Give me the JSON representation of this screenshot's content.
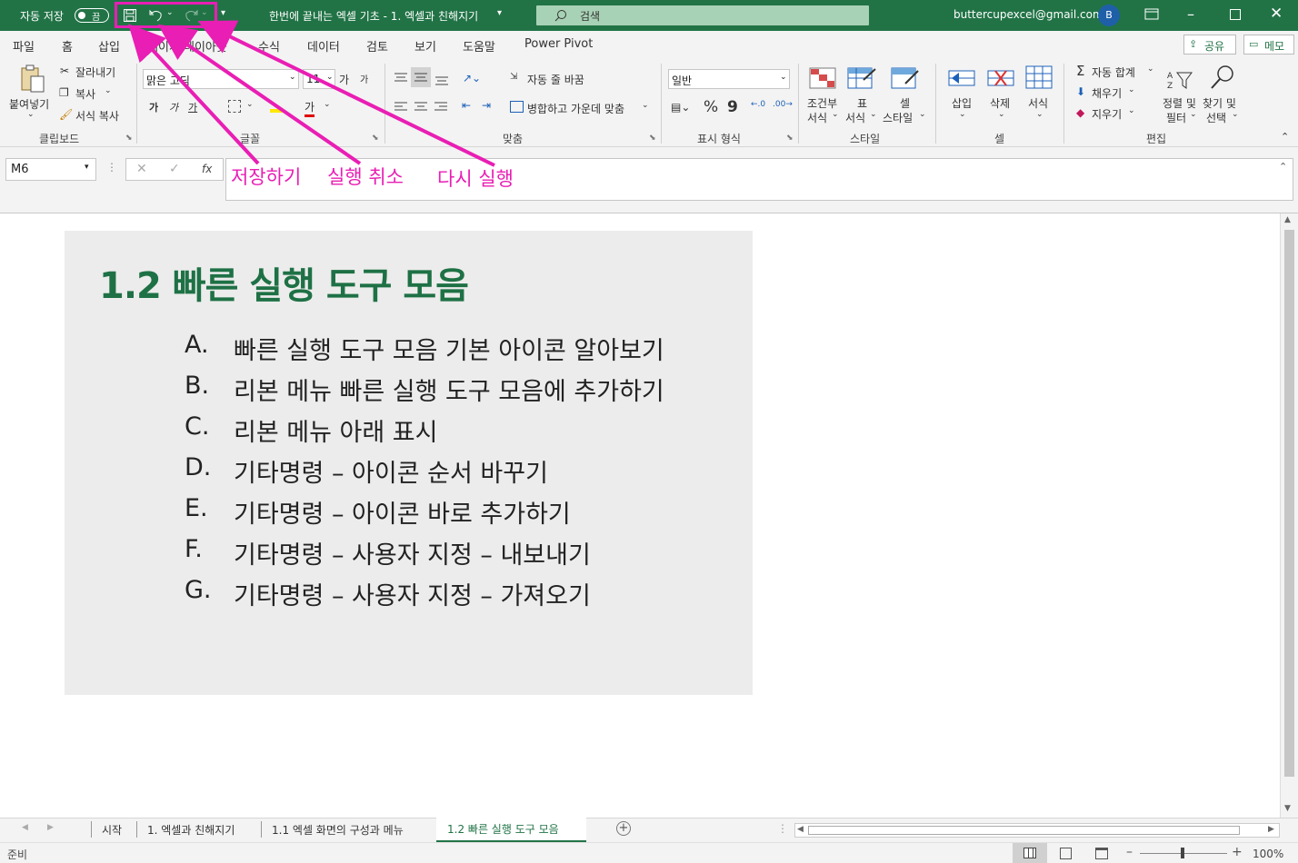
{
  "titlebar": {
    "autosave_label": "자동 저장",
    "autosave_state": "끔",
    "doc_title": "한번에 끝내는 엑셀 기초 - 1. 엑셀과 친해지기",
    "search_placeholder": "검색",
    "account_email": "buttercupexcel@gmail.com",
    "avatar_initial": "B"
  },
  "menu_tabs": [
    "파일",
    "홈",
    "삽입",
    "페이지 레이아웃",
    "수식",
    "데이터",
    "검토",
    "보기",
    "도움말",
    "Power Pivot"
  ],
  "share_label": "공유",
  "memo_label": "메모",
  "ribbon": {
    "clipboard": {
      "paste": "붙여넣기",
      "cut": "잘라내기",
      "copy": "복사",
      "format_painter": "서식 복사",
      "group": "클립보드"
    },
    "font": {
      "font_name": "맑은 고딕",
      "font_size": "11",
      "grow": "가",
      "shrink": "가",
      "bold": "가",
      "italic": "가",
      "underline": "가",
      "font_color": "가",
      "group": "글꼴"
    },
    "alignment": {
      "wrap": "자동 줄 바꿈",
      "merge": "병합하고 가운데 맞춤",
      "group": "맞춤"
    },
    "number": {
      "format": "일반",
      "percent": "%",
      "comma": "9",
      "group": "표시 형식"
    },
    "styles": {
      "conditional": "조건부\n서식",
      "table": "표\n서식",
      "cell": "셀\n스타일",
      "cond1": "조건부",
      "cond2": "서식",
      "table1": "표",
      "table2": "서식",
      "cell1": "셀",
      "cell2": "스타일",
      "group": "스타일"
    },
    "cells": {
      "insert": "삽입",
      "delete": "삭제",
      "format": "서식",
      "group": "셀"
    },
    "editing": {
      "autosum": "자동 합계",
      "fill": "채우기",
      "clear": "지우기",
      "sort1": "정렬 및",
      "sort2": "필터",
      "find1": "찾기 및",
      "find2": "선택",
      "group": "편집"
    }
  },
  "formula": {
    "name_box": "M6",
    "fx": "fx"
  },
  "annotations": {
    "save": "저장하기",
    "undo": "실행 취소",
    "redo": "다시 실행"
  },
  "content": {
    "title": "1.2 빠른 실행 도구 모음",
    "items": [
      {
        "letter": "A.",
        "text": "빠른 실행 도구 모음 기본 아이콘 알아보기"
      },
      {
        "letter": "B.",
        "text": "리본 메뉴 빠른 실행 도구 모음에 추가하기"
      },
      {
        "letter": "C.",
        "text": "리본 메뉴 아래 표시"
      },
      {
        "letter": "D.",
        "text": "기타명령 – 아이콘 순서 바꾸기"
      },
      {
        "letter": "E.",
        "text": "기타명령 – 아이콘 바로 추가하기"
      },
      {
        "letter": "F.",
        "text": "기타명령 – 사용자 지정 – 내보내기"
      },
      {
        "letter": "G.",
        "text": "기타명령 – 사용자 지정 – 가져오기"
      }
    ]
  },
  "sheet_tabs": [
    "시작",
    "1. 엑셀과 친해지기",
    "1.1 엑셀 화면의 구성과 메뉴",
    "1.2 빠른 실행 도구 모음"
  ],
  "active_sheet": "1.2 빠른 실행 도구 모음",
  "status": {
    "ready": "준비",
    "zoom": "100%"
  },
  "colors": {
    "excel_green": "#217346",
    "title_green": "#1e7145",
    "annotation_magenta": "#e91eb4",
    "content_bg": "#ececec"
  }
}
